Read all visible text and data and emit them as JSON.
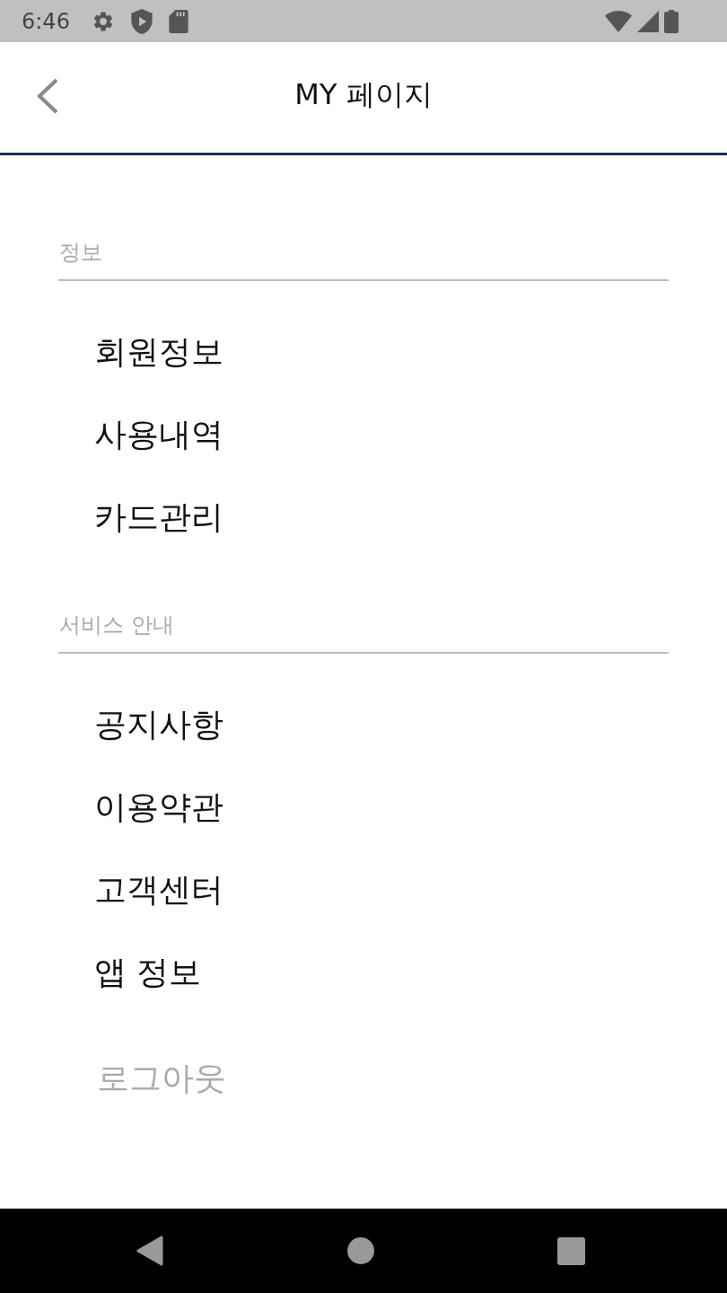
{
  "status_bar": {
    "time": "6:46"
  },
  "header": {
    "title": "MY 페이지"
  },
  "sections": [
    {
      "title": "정보",
      "items": [
        {
          "label": "회원정보"
        },
        {
          "label": "사용내역"
        },
        {
          "label": "카드관리"
        }
      ]
    },
    {
      "title": "서비스 안내",
      "items": [
        {
          "label": "공지사항"
        },
        {
          "label": "이용약관"
        },
        {
          "label": "고객센터"
        },
        {
          "label": "앱 정보"
        }
      ]
    }
  ],
  "logout": {
    "label": "로그아웃"
  }
}
